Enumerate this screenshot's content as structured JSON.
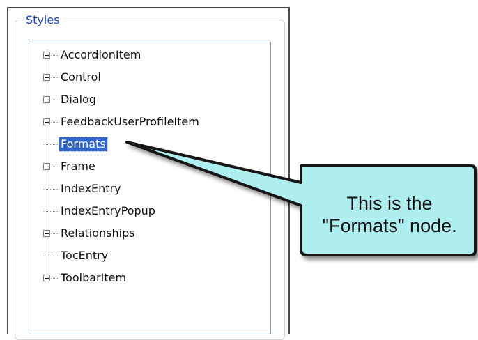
{
  "groupbox": {
    "title": "Styles"
  },
  "tree": {
    "items": [
      {
        "label": "AccordionItem",
        "expandable": true,
        "selected": false
      },
      {
        "label": "Control",
        "expandable": true,
        "selected": false
      },
      {
        "label": "Dialog",
        "expandable": true,
        "selected": false
      },
      {
        "label": "FeedbackUserProfileItem",
        "expandable": true,
        "selected": false
      },
      {
        "label": "Formats",
        "expandable": false,
        "selected": true
      },
      {
        "label": "Frame",
        "expandable": true,
        "selected": false
      },
      {
        "label": "IndexEntry",
        "expandable": false,
        "selected": false
      },
      {
        "label": "IndexEntryPopup",
        "expandable": false,
        "selected": false
      },
      {
        "label": "Relationships",
        "expandable": true,
        "selected": false
      },
      {
        "label": "TocEntry",
        "expandable": false,
        "selected": false
      },
      {
        "label": "ToolbarItem",
        "expandable": true,
        "selected": false
      }
    ]
  },
  "callout": {
    "line1": "This is the",
    "line2": "\"Formats\" node.",
    "fill_color": "#aeeeee"
  },
  "colors": {
    "selection": "#2f64c8",
    "legend_text": "#1a43c8"
  }
}
